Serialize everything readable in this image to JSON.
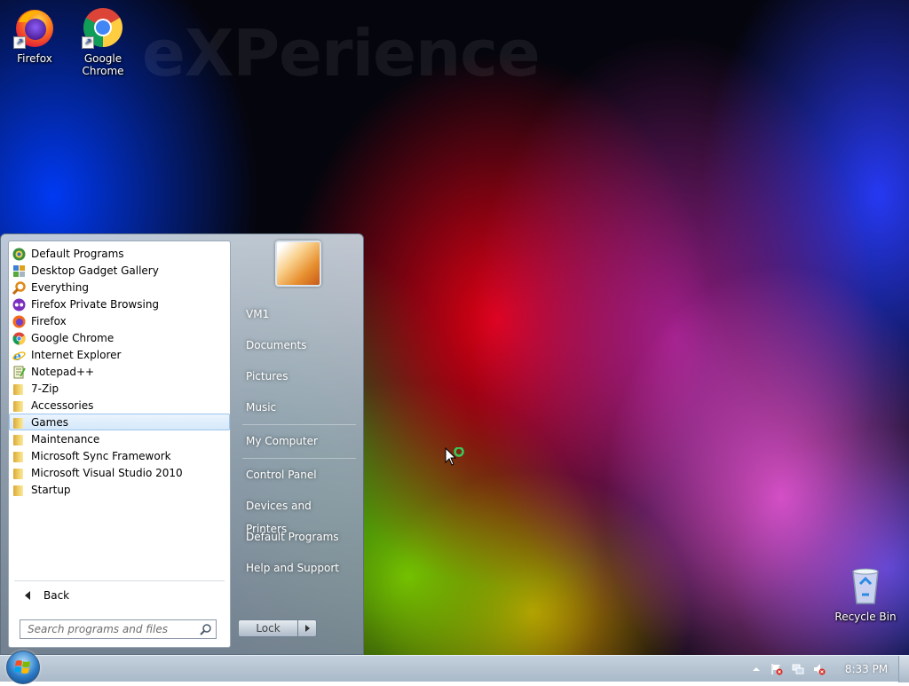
{
  "desktop": {
    "watermark": "eXPerience",
    "icons": [
      {
        "label": "Firefox",
        "icon": "firefox-icon"
      },
      {
        "label": "Google Chrome",
        "icon": "chrome-icon"
      },
      {
        "label": "Recycle Bin",
        "icon": "recycle-bin-icon"
      }
    ]
  },
  "start_menu": {
    "programs": [
      {
        "label": "Default Programs",
        "icon": "default-programs-icon"
      },
      {
        "label": "Desktop Gadget Gallery",
        "icon": "gadget-gallery-icon"
      },
      {
        "label": "Everything",
        "icon": "everything-search-icon"
      },
      {
        "label": "Firefox Private Browsing",
        "icon": "firefox-private-icon"
      },
      {
        "label": "Firefox",
        "icon": "firefox-icon"
      },
      {
        "label": "Google Chrome",
        "icon": "chrome-icon"
      },
      {
        "label": "Internet Explorer",
        "icon": "internet-explorer-icon"
      },
      {
        "label": "Notepad++",
        "icon": "notepad-plus-plus-icon"
      },
      {
        "label": "7-Zip",
        "icon": "folder-icon"
      },
      {
        "label": "Accessories",
        "icon": "folder-icon"
      },
      {
        "label": "Games",
        "icon": "folder-icon",
        "selected": true
      },
      {
        "label": "Maintenance",
        "icon": "folder-icon"
      },
      {
        "label": "Microsoft Sync Framework",
        "icon": "folder-icon"
      },
      {
        "label": "Microsoft Visual Studio 2010",
        "icon": "folder-icon"
      },
      {
        "label": "Startup",
        "icon": "folder-icon"
      }
    ],
    "back_label": "Back",
    "search_placeholder": "Search programs and files",
    "right_links": [
      {
        "label": "VM1"
      },
      {
        "label": "Documents"
      },
      {
        "label": "Pictures"
      },
      {
        "label": "Music"
      },
      {
        "label": "My Computer"
      },
      {
        "label": "Control Panel"
      },
      {
        "label": "Devices and Printers"
      },
      {
        "label": "Default Programs"
      },
      {
        "label": "Help and Support"
      }
    ],
    "lock_label": "Lock"
  },
  "taskbar": {
    "clock": "8:33 PM",
    "tray_icons": [
      "show-hidden-icons-chevron",
      "action-center-flag-icon",
      "network-icon",
      "volume-muted-icon"
    ]
  },
  "colors": {
    "selection_bg": "#d5e8fa",
    "selection_border": "#9cc6ee",
    "taskbar": "#b6c5d4"
  }
}
